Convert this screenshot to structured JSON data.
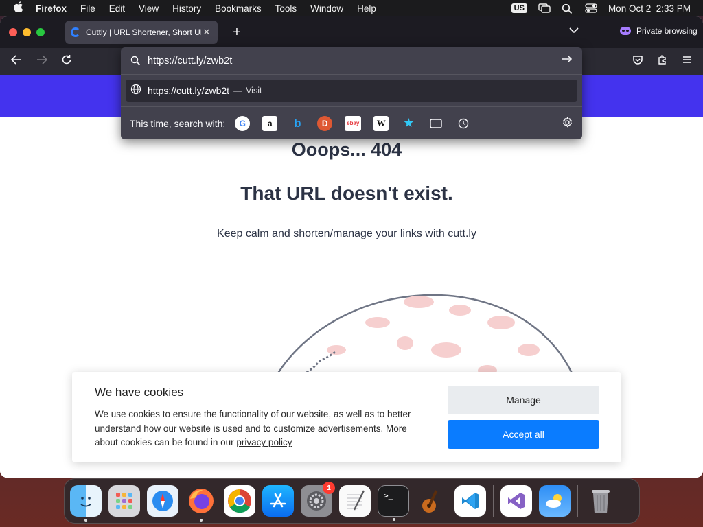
{
  "menubar": {
    "app_name": "Firefox",
    "items": [
      "File",
      "Edit",
      "View",
      "History",
      "Bookmarks",
      "Tools",
      "Window",
      "Help"
    ],
    "input_source": "US",
    "clock": "Mon Oct 2  2:33 PM"
  },
  "tab": {
    "title": "Cuttly | URL Shortener, Short UR",
    "close_glyph": "✕"
  },
  "toolbar": {
    "private_label": "Private browsing"
  },
  "urlbar": {
    "value": "https://cutt.ly/zwb2t",
    "suggestion_url": "https://cutt.ly/zwb2t",
    "suggestion_sep": "—",
    "suggestion_action": "Visit",
    "search_with_label": "This time, search with:",
    "engines": [
      "Google",
      "Amazon",
      "Bing",
      "DuckDuckGo",
      "eBay",
      "Wikipedia",
      "Bookmarks",
      "Tabs",
      "History"
    ]
  },
  "page": {
    "heading_404": "Ooops... 404",
    "heading_missing": "That URL doesn't exist.",
    "subtitle": "Keep calm and shorten/manage your links with cutt.ly",
    "accent_color": "#4433ee"
  },
  "cookie_banner": {
    "title": "We have cookies",
    "text": "We use cookies to ensure the functionality of our website, as well as to better understand how our website is used and to customize advertisements. More about cookies can be found in our",
    "link": "privacy policy",
    "manage_label": "Manage",
    "accept_label": "Accept all"
  },
  "dock": {
    "apps": [
      "Finder",
      "Launchpad",
      "Safari",
      "Firefox",
      "Chrome",
      "App Store",
      "System Settings",
      "TextEdit",
      "Terminal",
      "GarageBand",
      "Visual Studio Code",
      "Visual Studio",
      "Weather",
      "Trash"
    ],
    "settings_badge": "1"
  }
}
